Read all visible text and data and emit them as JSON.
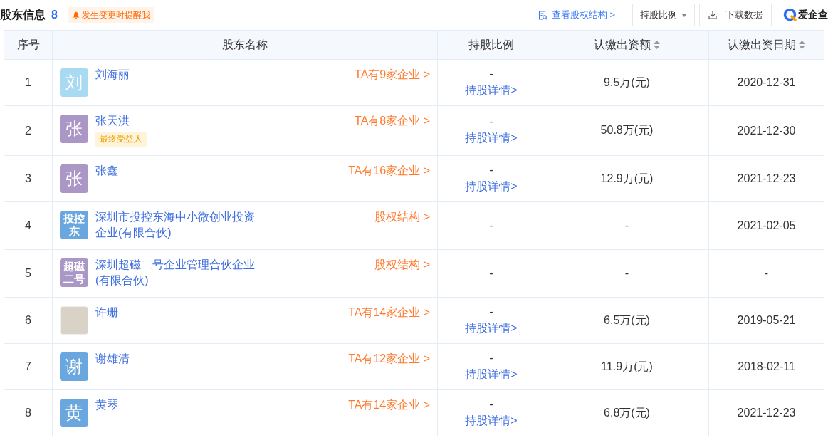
{
  "header": {
    "title": "股东信息",
    "count": "8",
    "remind": "发生变更时提醒我",
    "structure_link": "查看股权结构 >",
    "sort_dropdown": "持股比例",
    "download": "下载数据",
    "logo": "爱企查"
  },
  "table": {
    "columns": [
      {
        "label": "序号",
        "sortable": false
      },
      {
        "label": "股东名称",
        "sortable": false
      },
      {
        "label": "持股比例",
        "sortable": false
      },
      {
        "label": "认缴出资额",
        "sortable": true
      },
      {
        "label": "认缴出资日期",
        "sortable": true
      }
    ],
    "rows": [
      {
        "index": "1",
        "avatar": {
          "kind": "char",
          "text": "刘",
          "color": "#a8daf2"
        },
        "name": "刘海丽",
        "link": "TA有9家企业 >",
        "ratio": "-",
        "detail": "持股详情>",
        "amount": "9.5万(元)",
        "date": "2020-12-31"
      },
      {
        "index": "2",
        "avatar": {
          "kind": "char",
          "text": "张",
          "color": "#ab97c6"
        },
        "name": "张天洪",
        "tag": "最终受益人",
        "link": "TA有8家企业 >",
        "ratio": "-",
        "detail": "持股详情>",
        "amount": "50.8万(元)",
        "date": "2021-12-30"
      },
      {
        "index": "3",
        "avatar": {
          "kind": "char",
          "text": "张",
          "color": "#ab97c6"
        },
        "name": "张鑫",
        "link": "TA有16家企业 >",
        "ratio": "-",
        "detail": "持股详情>",
        "amount": "12.9万(元)",
        "date": "2021-12-23"
      },
      {
        "index": "4",
        "avatar": {
          "kind": "multi",
          "text": "投控东",
          "color": "#6aa7df"
        },
        "name": "深圳市投控东海中小微创业投资企业(有限合伙)",
        "link": "股权结构 >",
        "ratio": "-",
        "amount": "-",
        "date": "2021-02-05"
      },
      {
        "index": "5",
        "avatar": {
          "kind": "multi",
          "text": "超磁二号",
          "color": "#ab97c6"
        },
        "name": "深圳超磁二号企业管理合伙企业(有限合伙)",
        "link": "股权结构 >",
        "ratio": "-",
        "amount": "-",
        "date": "-"
      },
      {
        "index": "6",
        "avatar": {
          "kind": "photo"
        },
        "name": "许珊",
        "link": "TA有14家企业 >",
        "ratio": "-",
        "detail": "持股详情>",
        "amount": "6.5万(元)",
        "date": "2019-05-21"
      },
      {
        "index": "7",
        "avatar": {
          "kind": "char",
          "text": "谢",
          "color": "#6aa7df"
        },
        "name": "谢雄清",
        "link": "TA有12家企业 >",
        "ratio": "-",
        "detail": "持股详情>",
        "amount": "11.9万(元)",
        "date": "2018-02-11"
      },
      {
        "index": "8",
        "avatar": {
          "kind": "char",
          "text": "黄",
          "color": "#6aa7df"
        },
        "name": "黄琴",
        "link": "TA有14家企业 >",
        "ratio": "-",
        "detail": "持股详情>",
        "amount": "6.8万(元)",
        "date": "2021-12-23"
      }
    ]
  }
}
